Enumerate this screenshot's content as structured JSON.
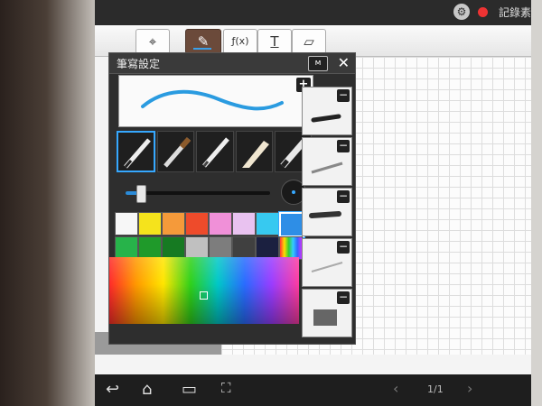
{
  "top_bar": {
    "settings_icon": "gear-icon",
    "record_label": "記錄素"
  },
  "toolbar": {
    "tools": [
      {
        "name": "select-tool",
        "glyph": "⌖",
        "active": false
      },
      {
        "name": "pen-tool",
        "glyph": "✎",
        "active": true
      },
      {
        "name": "formula-tool",
        "glyph": "ƒ(x)",
        "active": false
      },
      {
        "name": "text-tool",
        "glyph": "T",
        "active": false
      },
      {
        "name": "eraser-tool",
        "glyph": "▱",
        "active": false
      }
    ]
  },
  "pen_settings": {
    "title": "筆寫設定",
    "preset_button": "ᴍ",
    "close_glyph": "✕",
    "add_glyph": "+",
    "preview_stroke_color": "#2a9be0",
    "pens": [
      "fountain-pen",
      "brush",
      "pencil",
      "calligraphy-pen",
      "marker"
    ],
    "selected_pen_index": 0,
    "size_level": 0.1,
    "swatch_colors": [
      "#f7f7f7",
      "#f5e31c",
      "#f59a3a",
      "#ee4b2b",
      "#f090d8",
      "#e9c2f0",
      "#37c9f0",
      "#2e8ee6",
      "#27b34a",
      "#1f9a2a",
      "#167a22",
      "#c0c0c0",
      "#7d7d7d",
      "#404040",
      "#1b2040",
      "rainbow"
    ],
    "selected_swatch_index": 7,
    "presets": [
      "preset-1",
      "preset-2",
      "preset-3",
      "preset-4",
      "preset-5"
    ],
    "remove_glyph": "−"
  },
  "bottom_nav": {
    "page_indicator": "1/1"
  }
}
